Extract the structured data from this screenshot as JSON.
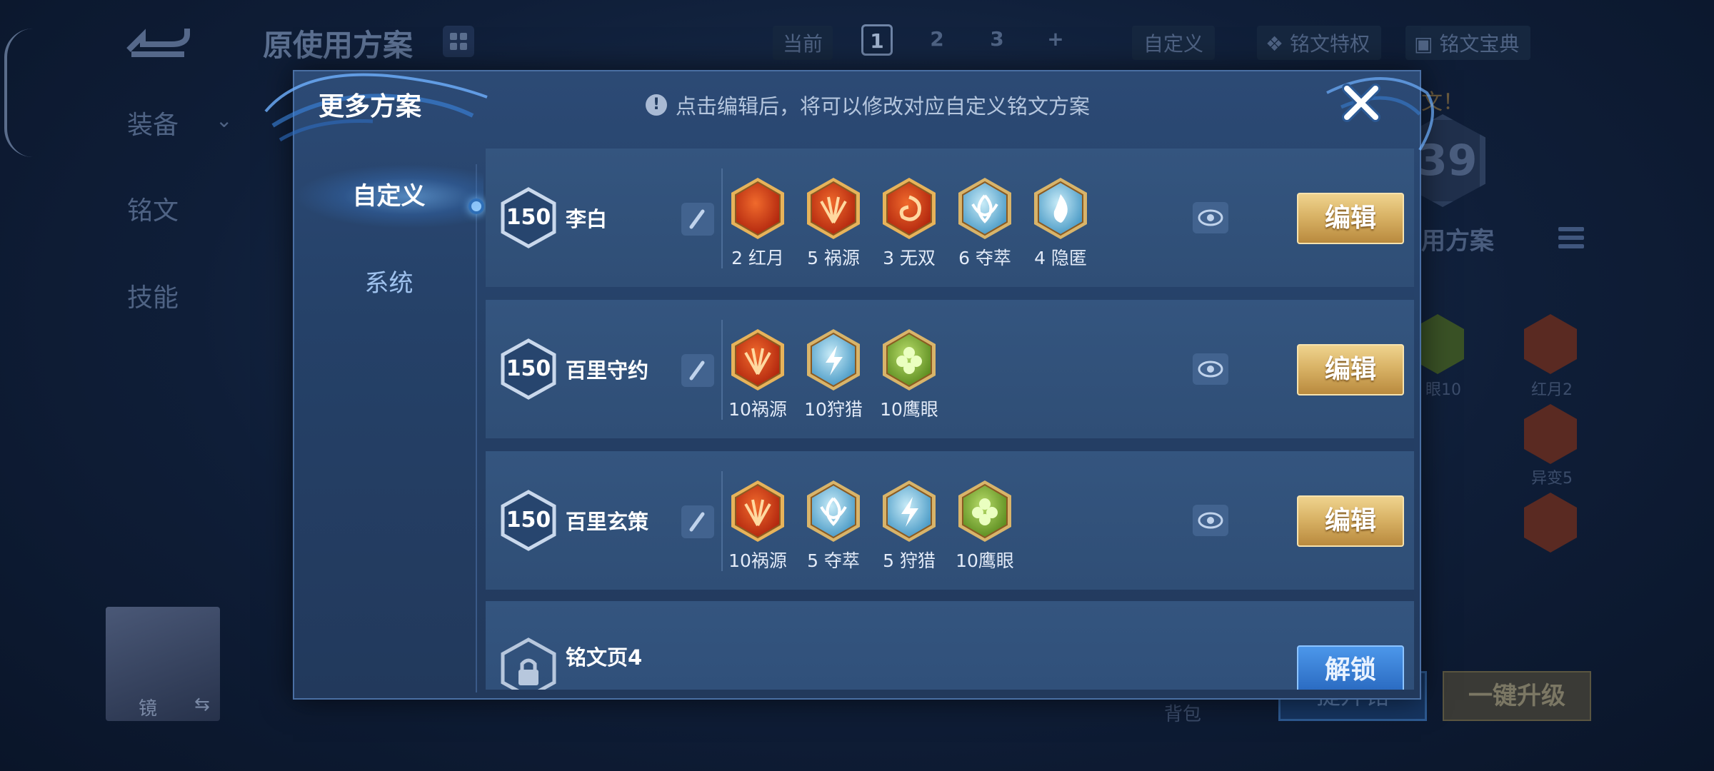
{
  "background": {
    "title": "原使用方案",
    "current_label": "当前",
    "pages": [
      "1",
      "2",
      "3",
      "+"
    ],
    "custom_label": "自定义",
    "tool_privilege": "铭文特权",
    "tool_guide": "铭文宝典",
    "side_nav": [
      "装备",
      "铭文",
      "技能"
    ],
    "hero_name": "镜",
    "swap_icon": "⇆",
    "right_panel": {
      "warning_fragment": "文！",
      "level_fragment": "39",
      "plan_label_fragment": "用方案",
      "rune_labels": [
        "眼10",
        "红月2",
        "异变5"
      ]
    },
    "bag_label": "背包",
    "btn_upgrade_fragment": "提升铭",
    "btn_one_key": "一键升级"
  },
  "modal": {
    "title": "更多方案",
    "hint_icon": "!",
    "hint": "点击编辑后，将可以修改对应自定义铭文方案",
    "tabs": [
      {
        "label": "自定义",
        "active": true
      },
      {
        "label": "系统",
        "active": false
      }
    ],
    "plans": [
      {
        "level": "150",
        "name": "李白",
        "runes": [
          {
            "label": "2 红月",
            "icon": "red-moon-rune-icon",
            "color": "red",
            "symbol": "moon"
          },
          {
            "label": "5 祸源",
            "icon": "calamity-rune-icon",
            "color": "red",
            "symbol": "fan"
          },
          {
            "label": "3 无双",
            "icon": "peerless-rune-icon",
            "color": "red",
            "symbol": "swirl"
          },
          {
            "label": "6 夺萃",
            "icon": "plunder-rune-icon",
            "color": "blue",
            "symbol": "knot"
          },
          {
            "label": "4 隐匿",
            "icon": "stealth-rune-icon",
            "color": "blue",
            "symbol": "flame"
          }
        ],
        "edit_label": "编辑"
      },
      {
        "level": "150",
        "name": "百里守约",
        "runes": [
          {
            "label": "10祸源",
            "icon": "calamity-rune-icon",
            "color": "red",
            "symbol": "fan"
          },
          {
            "label": "10狩猎",
            "icon": "hunt-rune-icon",
            "color": "blue",
            "symbol": "bolt"
          },
          {
            "label": "10鹰眼",
            "icon": "eagle-eye-rune-icon",
            "color": "green",
            "symbol": "clover"
          }
        ],
        "edit_label": "编辑"
      },
      {
        "level": "150",
        "name": "百里玄策",
        "runes": [
          {
            "label": "10祸源",
            "icon": "calamity-rune-icon",
            "color": "red",
            "symbol": "fan"
          },
          {
            "label": "5 夺萃",
            "icon": "plunder-rune-icon",
            "color": "blue",
            "symbol": "knot"
          },
          {
            "label": "5 狩猎",
            "icon": "hunt-rune-icon",
            "color": "blue",
            "symbol": "bolt"
          },
          {
            "label": "10鹰眼",
            "icon": "eagle-eye-rune-icon",
            "color": "green",
            "symbol": "clover"
          }
        ],
        "edit_label": "编辑"
      }
    ],
    "locked_page": {
      "name": "铭文页4",
      "unlock_label": "解锁"
    }
  },
  "colors": {
    "gold_button": "#d9b366",
    "red_rune": "#d8461e",
    "blue_rune": "#7fc7e8",
    "green_rune": "#7fb33a"
  }
}
